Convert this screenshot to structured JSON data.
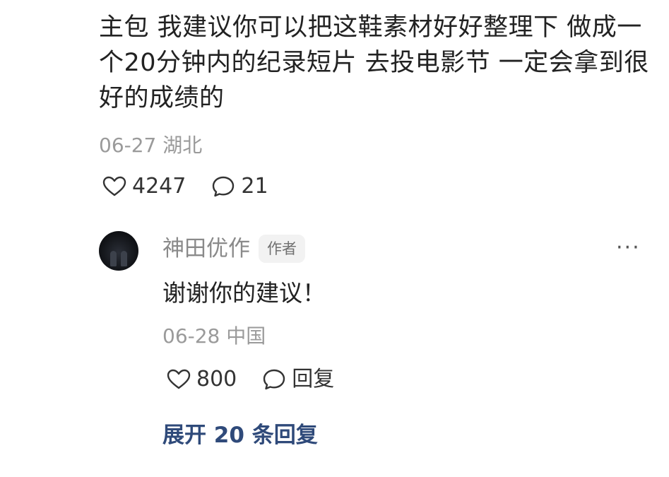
{
  "main_comment": {
    "lines": [
      "主包 我建议你可以把这鞋素材好好整理下 做成一",
      "个20分钟内的纪录短片 去投电影节 一定会拿到很",
      "好的成绩的"
    ],
    "date": "06-27",
    "location": "湖北",
    "likes": "4247",
    "comments": "21"
  },
  "reply": {
    "author": "神田优作",
    "badge": "作者",
    "text": "谢谢你的建议！",
    "date": "06-28",
    "location": "中国",
    "likes": "800",
    "reply_label": "回复",
    "more_label": "···"
  },
  "expand_label": "展开 20 条回复",
  "colors": {
    "text": "#222222",
    "meta": "#9a9a9a",
    "link": "#2f4a7a",
    "badge_bg": "#f2f2f2"
  },
  "icons": [
    "heart-icon",
    "comment-bubble-icon",
    "more-icon"
  ]
}
